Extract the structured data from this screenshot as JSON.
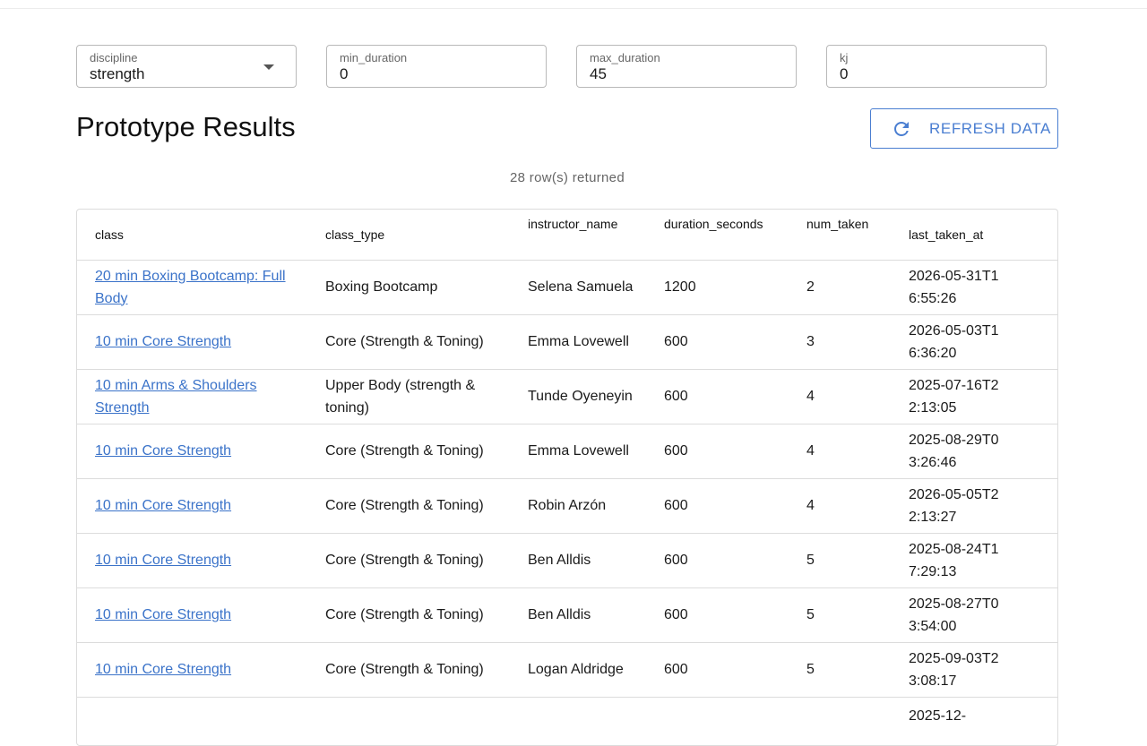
{
  "filters": {
    "discipline": {
      "label": "discipline",
      "value": "strength"
    },
    "min_duration": {
      "label": "min_duration",
      "value": "0"
    },
    "max_duration": {
      "label": "max_duration",
      "value": "45"
    },
    "kj": {
      "label": "kj",
      "value": "0"
    }
  },
  "header": {
    "title": "Prototype Results",
    "refresh_label": "REFRESH DATA"
  },
  "status": {
    "row_count_text": "28 row(s) returned"
  },
  "colors": {
    "accent": "#4a7ed1",
    "link": "#3b73c9"
  },
  "table": {
    "columns": [
      "class",
      "class_type",
      "instructor_name",
      "duration_seconds",
      "num_taken",
      "last_taken_at"
    ],
    "rows": [
      {
        "class": "20 min Boxing Bootcamp: Full Body",
        "class_type": "Boxing Bootcamp",
        "instructor_name": "Selena Samuela",
        "duration_seconds": "1200",
        "num_taken": "2",
        "last_taken_at": "2026-05-31T16:55:26"
      },
      {
        "class": "10 min Core Strength",
        "class_type": "Core (Strength & Toning)",
        "instructor_name": "Emma Lovewell",
        "duration_seconds": "600",
        "num_taken": "3",
        "last_taken_at": "2026-05-03T16:36:20"
      },
      {
        "class": "10 min Arms & Shoulders Strength",
        "class_type": "Upper Body (strength & toning)",
        "instructor_name": "Tunde Oyeneyin",
        "duration_seconds": "600",
        "num_taken": "4",
        "last_taken_at": "2025-07-16T22:13:05"
      },
      {
        "class": "10 min Core Strength",
        "class_type": "Core (Strength & Toning)",
        "instructor_name": "Emma Lovewell",
        "duration_seconds": "600",
        "num_taken": "4",
        "last_taken_at": "2025-08-29T03:26:46"
      },
      {
        "class": "10 min Core Strength",
        "class_type": "Core (Strength & Toning)",
        "instructor_name": "Robin Arzón",
        "duration_seconds": "600",
        "num_taken": "4",
        "last_taken_at": "2026-05-05T22:13:27"
      },
      {
        "class": "10 min Core Strength",
        "class_type": "Core (Strength & Toning)",
        "instructor_name": "Ben Alldis",
        "duration_seconds": "600",
        "num_taken": "5",
        "last_taken_at": "2025-08-24T17:29:13"
      },
      {
        "class": "10 min Core Strength",
        "class_type": "Core (Strength & Toning)",
        "instructor_name": "Ben Alldis",
        "duration_seconds": "600",
        "num_taken": "5",
        "last_taken_at": "2025-08-27T03:54:00"
      },
      {
        "class": "10 min Core Strength",
        "class_type": "Core (Strength & Toning)",
        "instructor_name": "Logan Aldridge",
        "duration_seconds": "600",
        "num_taken": "5",
        "last_taken_at": "2025-09-03T23:08:17"
      },
      {
        "class": "",
        "class_type": "",
        "instructor_name": "",
        "duration_seconds": "",
        "num_taken": "",
        "last_taken_at": "2025-12-"
      }
    ]
  }
}
